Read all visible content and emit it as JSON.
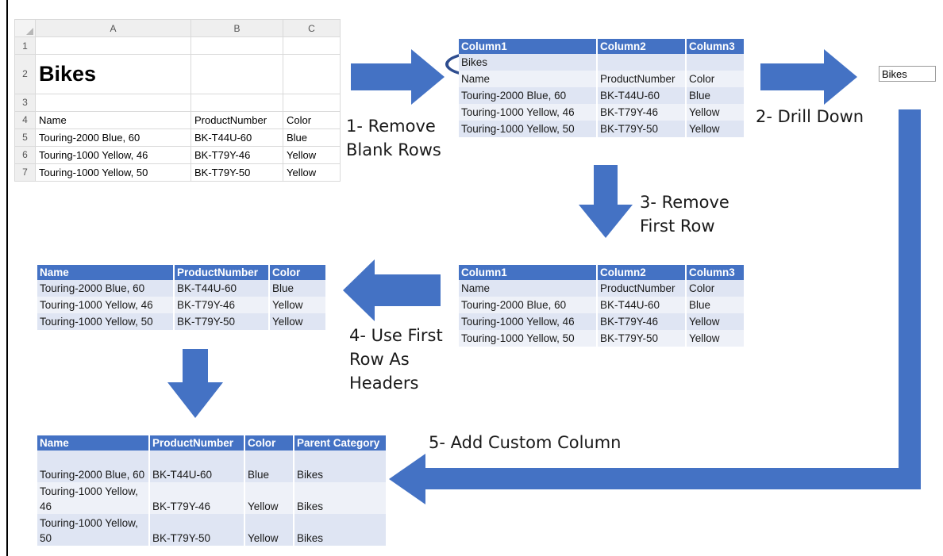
{
  "excel": {
    "col_headers": [
      "A",
      "B",
      "C"
    ],
    "row_numbers": [
      "1",
      "2",
      "3",
      "4",
      "5",
      "6",
      "7"
    ],
    "title": "Bikes",
    "header": [
      "Name",
      "ProductNumber",
      "Color"
    ],
    "rows": [
      [
        "Touring-2000 Blue, 60",
        "BK-T44U-60",
        "Blue"
      ],
      [
        "Touring-1000 Yellow, 46",
        "BK-T79Y-46",
        "Yellow"
      ],
      [
        "Touring-1000 Yellow, 50",
        "BK-T79Y-50",
        "Yellow"
      ]
    ]
  },
  "table1": {
    "headers": [
      "Column1",
      "Column2",
      "Column3"
    ],
    "rows": [
      [
        "Bikes",
        "",
        ""
      ],
      [
        "Name",
        "ProductNumber",
        "Color"
      ],
      [
        "Touring-2000 Blue, 60",
        "BK-T44U-60",
        "Blue"
      ],
      [
        "Touring-1000 Yellow, 46",
        "BK-T79Y-46",
        "Yellow"
      ],
      [
        "Touring-1000 Yellow, 50",
        "BK-T79Y-50",
        "Yellow"
      ]
    ]
  },
  "drill_value": "Bikes",
  "table3": {
    "headers": [
      "Column1",
      "Column2",
      "Column3"
    ],
    "rows": [
      [
        "Name",
        "ProductNumber",
        "Color"
      ],
      [
        "Touring-2000 Blue, 60",
        "BK-T44U-60",
        "Blue"
      ],
      [
        "Touring-1000 Yellow, 46",
        "BK-T79Y-46",
        "Yellow"
      ],
      [
        "Touring-1000 Yellow, 50",
        "BK-T79Y-50",
        "Yellow"
      ]
    ]
  },
  "table4": {
    "headers": [
      "Name",
      "ProductNumber",
      "Color"
    ],
    "rows": [
      [
        "Touring-2000 Blue, 60",
        "BK-T44U-60",
        "Blue"
      ],
      [
        "Touring-1000 Yellow, 46",
        "BK-T79Y-46",
        "Yellow"
      ],
      [
        "Touring-1000 Yellow, 50",
        "BK-T79Y-50",
        "Yellow"
      ]
    ]
  },
  "table5": {
    "headers": [
      "Name",
      "ProductNumber",
      "Color",
      "Parent Category"
    ],
    "rows": [
      [
        "Touring-2000 Blue, 60",
        "BK-T44U-60",
        "Blue",
        "Bikes"
      ],
      [
        "Touring-1000 Yellow, 46",
        "BK-T79Y-46",
        "Yellow",
        "Bikes"
      ],
      [
        "Touring-1000 Yellow, 50",
        "BK-T79Y-50",
        "Yellow",
        "Bikes"
      ]
    ]
  },
  "steps": {
    "s1": "1- Remove\nBlank Rows",
    "s2": "2- Drill Down",
    "s3": "3- Remove\nFirst Row",
    "s4": "4- Use First\nRow As\nHeaders",
    "s5": "5- Add Custom Column"
  },
  "colors": {
    "arrow": "#4472c4",
    "header": "#4472c4",
    "ellipse": "#2e4d8f"
  }
}
